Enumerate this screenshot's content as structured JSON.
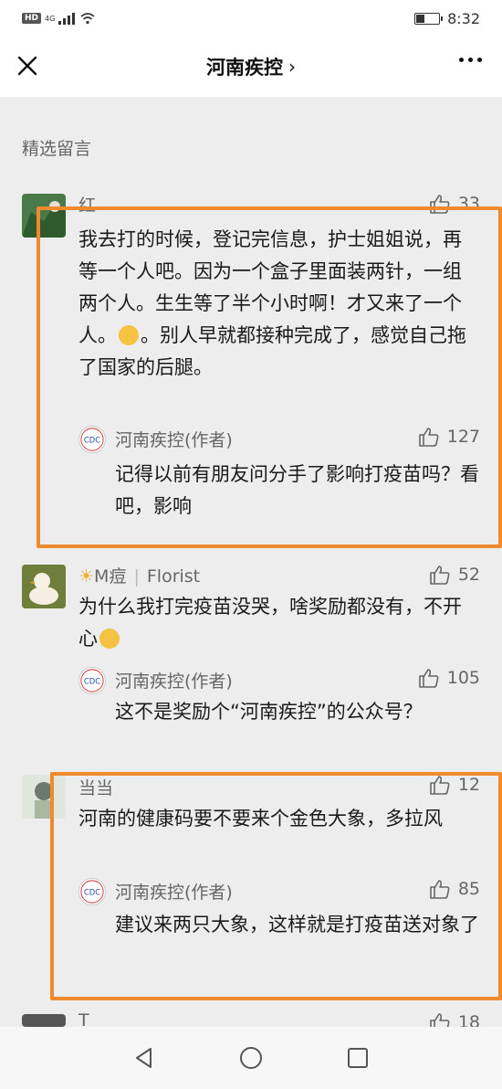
{
  "status_bar": {
    "hd": "HD",
    "network": "4G",
    "time": "8:32",
    "battery_level": 0.35
  },
  "nav": {
    "title": "河南疾控",
    "chevron": "›"
  },
  "section_title": "精选留言",
  "comments": [
    {
      "name": "红",
      "likes": "33",
      "text_before_emoji": "我去打的时候，登记完信息，护士姐姐说，再等一个人吧。因为一个盒子里面装两针，一组两个人。生生等了半个小时啊！才又来了一个人。",
      "text_after_emoji": "。别人早就都接种完成了，感觉自己拖了国家的后腿。",
      "reply": {
        "author": "河南疾控(作者)",
        "likes": "127",
        "text": "记得以前有朋友问分手了影响打疫苗吗？看吧，影响"
      }
    },
    {
      "name": "M痘",
      "tag": "Florist",
      "likes": "52",
      "text": "为什么我打完疫苗没哭，啥奖励都没有，不开心",
      "reply": {
        "author": "河南疾控(作者)",
        "likes": "105",
        "text": "这不是奖励个“河南疾控”的公众号？"
      }
    },
    {
      "name": "当当",
      "likes": "12",
      "text": "河南的健康码要不要来个金色大象，多拉风",
      "reply": {
        "author": "河南疾控(作者)",
        "likes": "85",
        "text": "建议来两只大象，这样就是打疫苗送对象了"
      }
    },
    {
      "name": "T",
      "likes": "18"
    }
  ],
  "colors": {
    "highlight": "#f08a2e",
    "background": "#ededed"
  },
  "icons": {
    "close": "close-icon",
    "more": "more-icon",
    "like": "thumbs-up-icon",
    "back": "back-triangle-icon",
    "home": "home-circle-icon",
    "recent": "recent-square-icon"
  }
}
